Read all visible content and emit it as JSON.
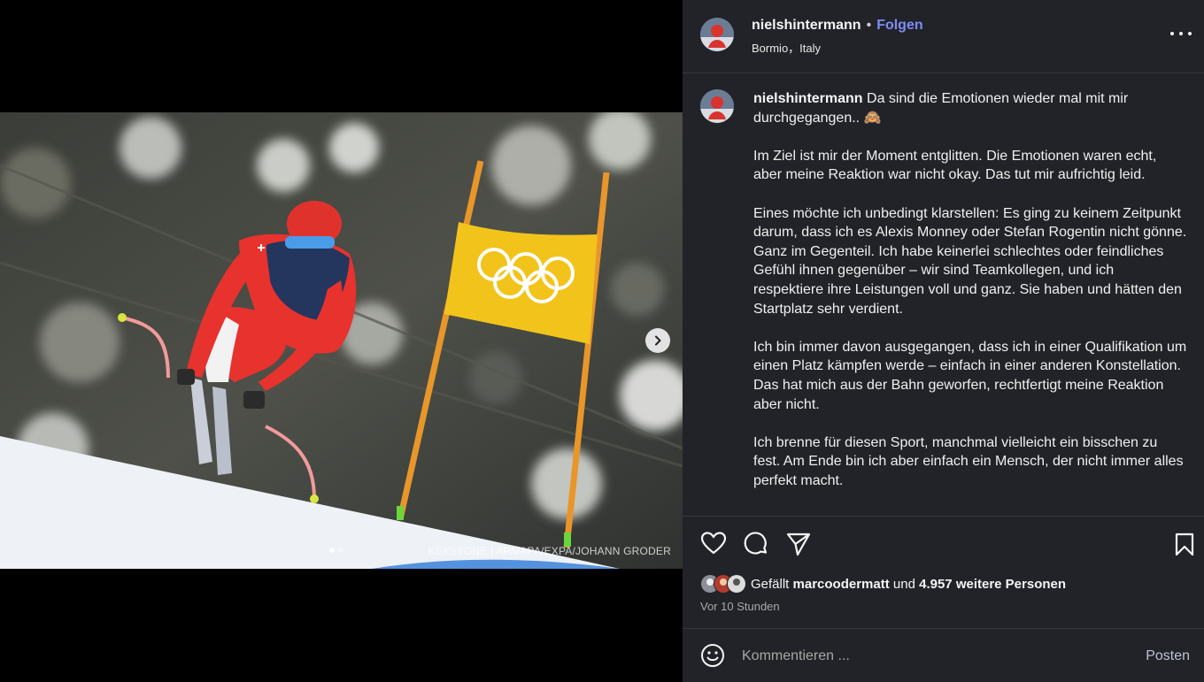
{
  "post": {
    "photo_credit": "KEYSTONE | APA/APA/EXPA/JOHANN GRODER",
    "carousel": {
      "slide_count": 2,
      "current": 1
    }
  },
  "header": {
    "username": "nielshintermann",
    "separator": "•",
    "follow_label": "Folgen",
    "location": "Bormio，Italy"
  },
  "caption": {
    "username": "nielshintermann",
    "first_line": "Da sind die Emotionen wieder mal mit mir durchgegangen.. 🙈",
    "paragraphs": [
      "Im Ziel ist mir der Moment entglitten. Die Emotionen waren echt, aber meine Reaktion war nicht okay. Das tut mir aufrichtig leid.",
      "Eines möchte ich unbedingt klarstellen: Es ging zu keinem Zeitpunkt darum, dass ich es Alexis Monney oder Stefan Rogentin nicht gönne. Ganz im Gegenteil. Ich habe keinerlei schlechtes oder feindliches Gefühl ihnen gegenüber – wir sind Teamkollegen, und ich respektiere ihre Leistungen voll und ganz. Sie haben und hätten den Startplatz sehr verdient.",
      "Ich bin immer davon ausgegangen, dass ich in einer Qualifikation um einen Platz kämpfen werde – einfach in einer anderen Konstellation. Das hat mich aus der Bahn geworfen, rechtfertigt meine Reaktion aber nicht.",
      "Ich brenne für diesen Sport, manchmal vielleicht ein bisschen zu fest. Am Ende bin ich aber einfach ein Mensch, der nicht immer alles perfekt macht."
    ]
  },
  "actions": {
    "likes_prefix": "Gefällt",
    "likes_user": "marcoodermatt",
    "likes_connector": "und",
    "likes_count_text": "4.957 weitere Personen",
    "timestamp": "Vor 10 Stunden"
  },
  "comment": {
    "placeholder": "Kommentieren ...",
    "post_label": "Posten"
  },
  "colors": {
    "panel_bg": "#212328",
    "follow_blue": "#7f8cf6",
    "gate_yellow": "#f2c31b"
  }
}
